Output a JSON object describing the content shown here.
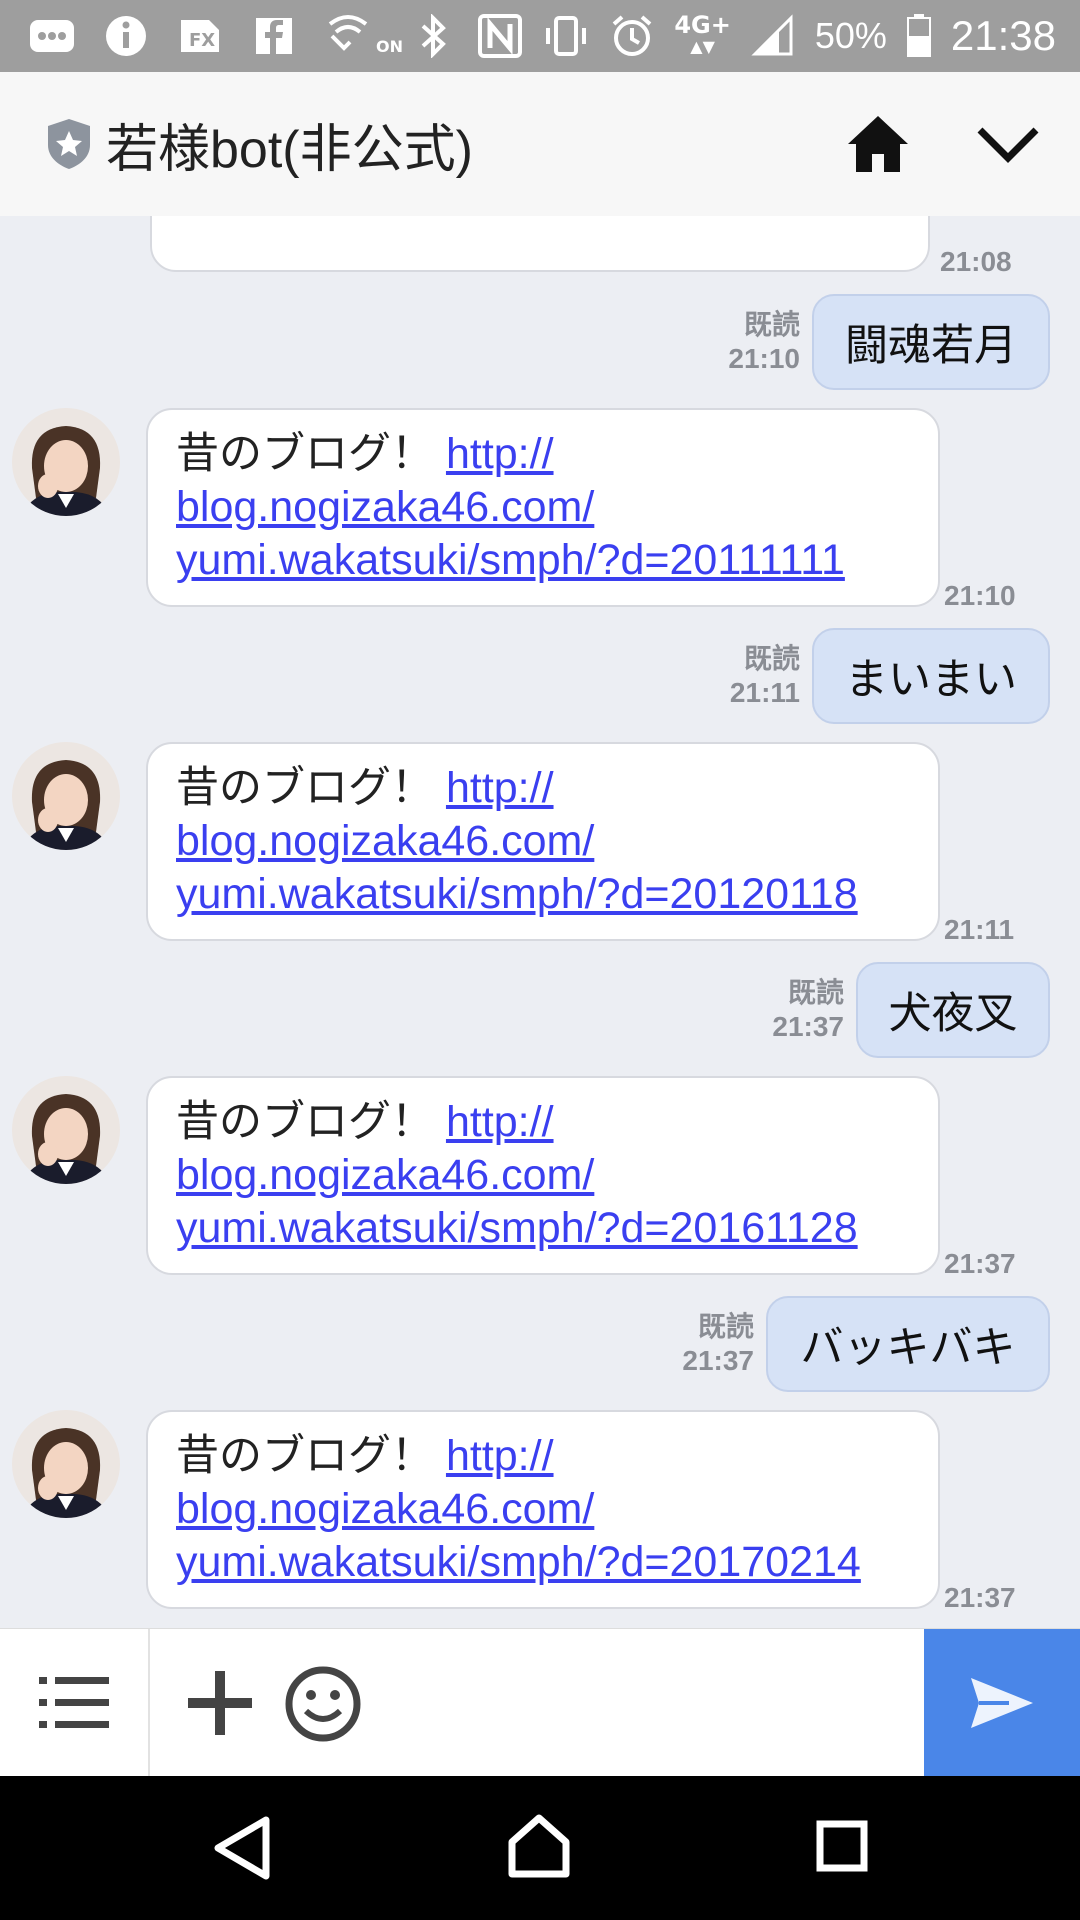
{
  "status_bar": {
    "battery": "50%",
    "time": "21:38",
    "network": "4G+",
    "cast_label": "ON",
    "icons": [
      "more-icon",
      "info-icon",
      "fx-icon",
      "facebook-icon",
      "wifi-calling-icon",
      "bluetooth-icon",
      "nfc-icon",
      "vibrate-icon",
      "alarm-icon",
      "signal-icon",
      "battery-icon"
    ]
  },
  "header": {
    "title": "若様bot(非公式)",
    "icons": [
      "shield-star-icon",
      "home-icon",
      "chevron-down-icon"
    ]
  },
  "messages": [
    {
      "type": "in-partial",
      "time": "21:08"
    },
    {
      "type": "out",
      "text": "闘魂若月",
      "read": "既読",
      "time": "21:10"
    },
    {
      "type": "in",
      "prefix": "昔のブログ！",
      "link": [
        "http://",
        "blog.nogizaka46.com/",
        "yumi.wakatsuki/smph/?d=20111111"
      ],
      "time": "21:10"
    },
    {
      "type": "out",
      "text": "まいまい",
      "read": "既読",
      "time": "21:11"
    },
    {
      "type": "in",
      "prefix": "昔のブログ！",
      "link": [
        "http://",
        "blog.nogizaka46.com/",
        "yumi.wakatsuki/smph/?d=20120118"
      ],
      "time": "21:11"
    },
    {
      "type": "out",
      "text": "犬夜叉",
      "read": "既読",
      "time": "21:37"
    },
    {
      "type": "in",
      "prefix": "昔のブログ！",
      "link": [
        "http://",
        "blog.nogizaka46.com/",
        "yumi.wakatsuki/smph/?d=20161128"
      ],
      "time": "21:37"
    },
    {
      "type": "out",
      "text": "バッキバキ",
      "read": "既読",
      "time": "21:37"
    },
    {
      "type": "in",
      "prefix": "昔のブログ！",
      "link": [
        "http://",
        "blog.nogizaka46.com/",
        "yumi.wakatsuki/smph/?d=20170214"
      ],
      "time": "21:37"
    }
  ],
  "input_bar": {
    "icons": [
      "menu-icon",
      "plus-icon",
      "emoji-icon",
      "send-icon"
    ],
    "accent_color": "#4a86e8"
  },
  "nav_bar": {
    "icons": [
      "back-icon",
      "home-icon",
      "recent-apps-icon"
    ]
  }
}
